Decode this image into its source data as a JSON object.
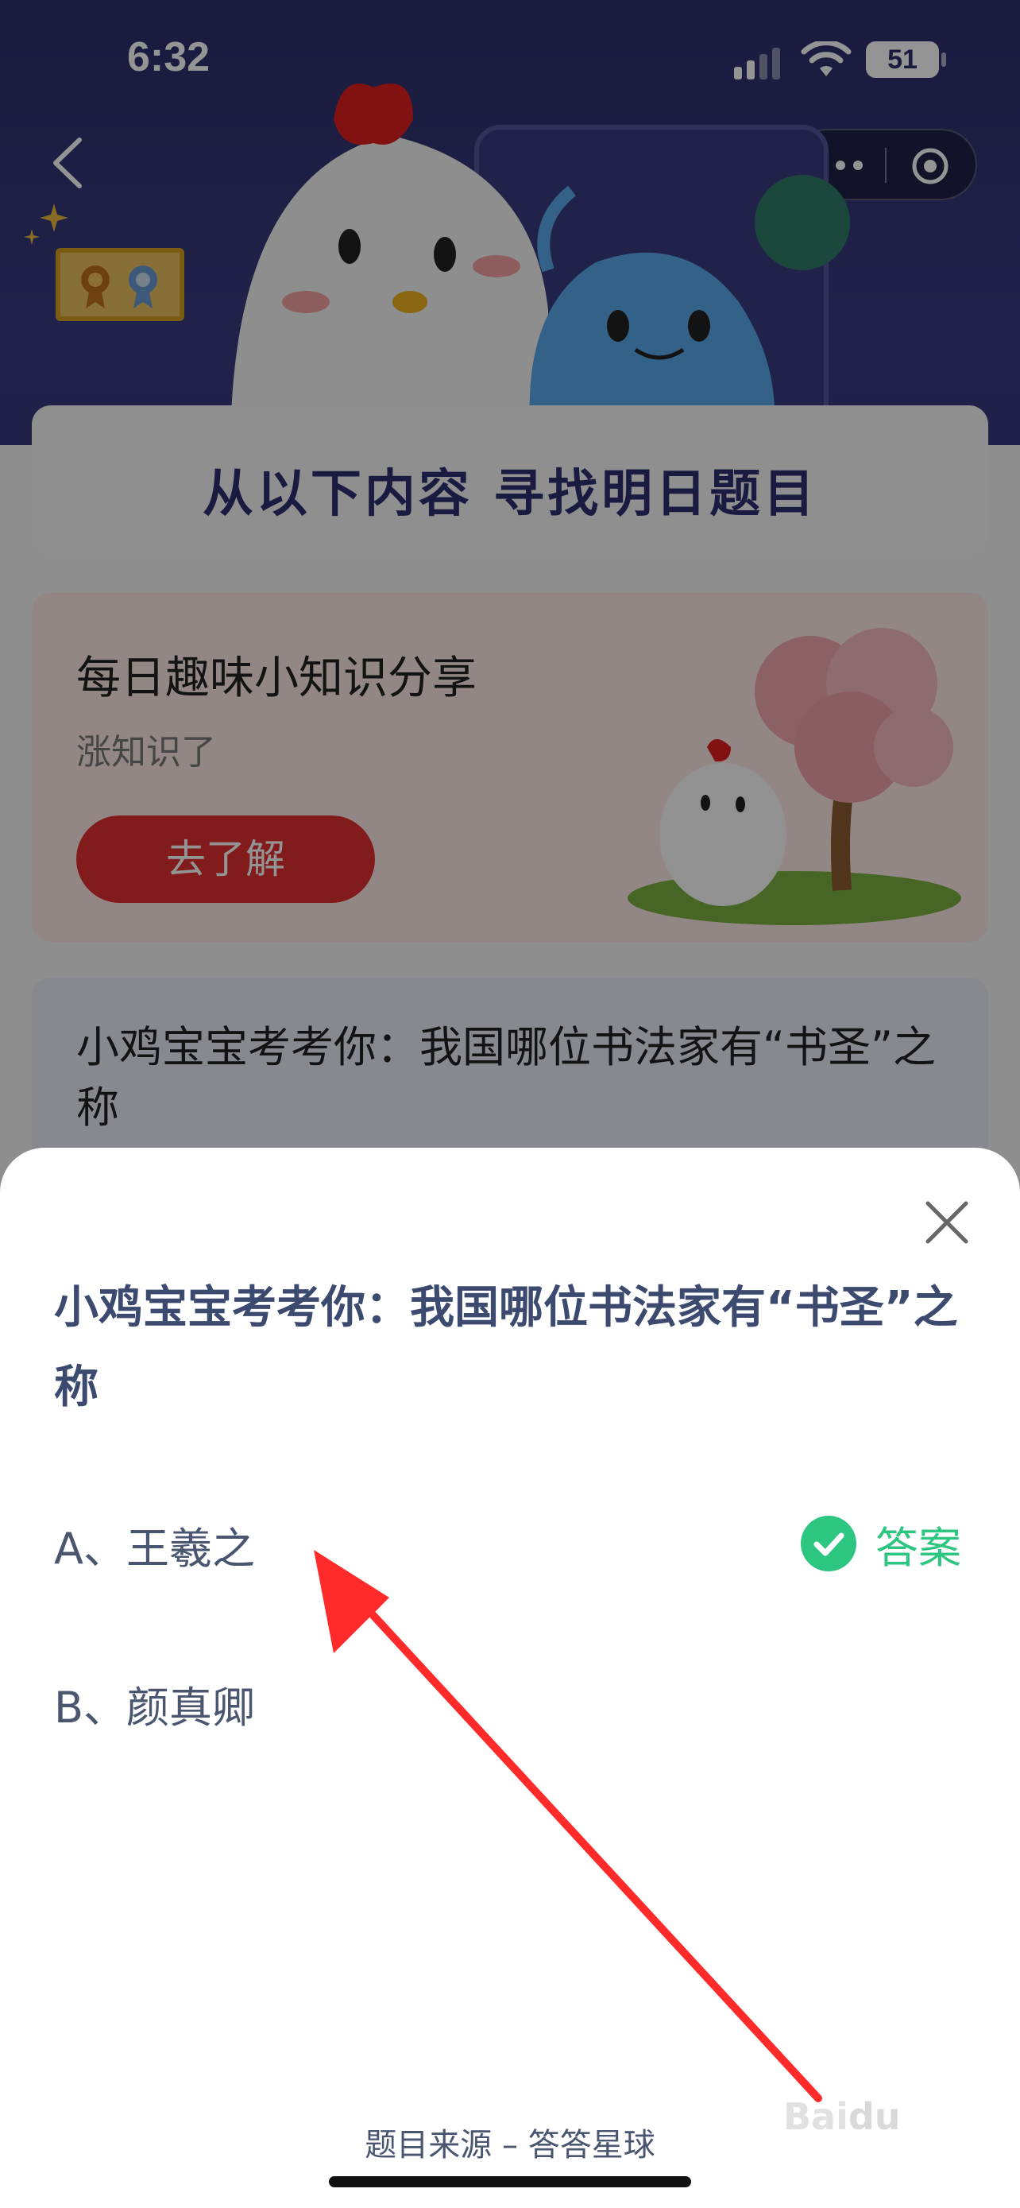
{
  "status_bar": {
    "time": "6:32",
    "battery": "51"
  },
  "background": {
    "find_title": "从以下内容  寻找明日题目",
    "fun_card": {
      "title": "每日趣味小知识分享",
      "subtitle": "涨知识了",
      "button": "去了解"
    },
    "question_card": {
      "title": "小鸡宝宝考考你：我国哪位书法家有“书圣”之称"
    }
  },
  "sheet": {
    "question": "小鸡宝宝考考你：我国哪位书法家有“书圣”之称",
    "options": [
      {
        "label": "A、王羲之",
        "is_answer": true
      },
      {
        "label": "B、颜真卿",
        "is_answer": false
      }
    ],
    "answer_label": "答案",
    "source": "题目来源 – 答答星球"
  },
  "colors": {
    "header_bg": "#2c2e6a",
    "fun_button": "#e03030",
    "answer_green": "#2cc680",
    "arrow_red": "#ff2a2a",
    "question_text": "#3b4a6e"
  },
  "icons": [
    "back-icon",
    "star-icon",
    "more-icon",
    "target-icon",
    "close-icon",
    "check-icon",
    "wifi-icon",
    "signal-icon"
  ]
}
